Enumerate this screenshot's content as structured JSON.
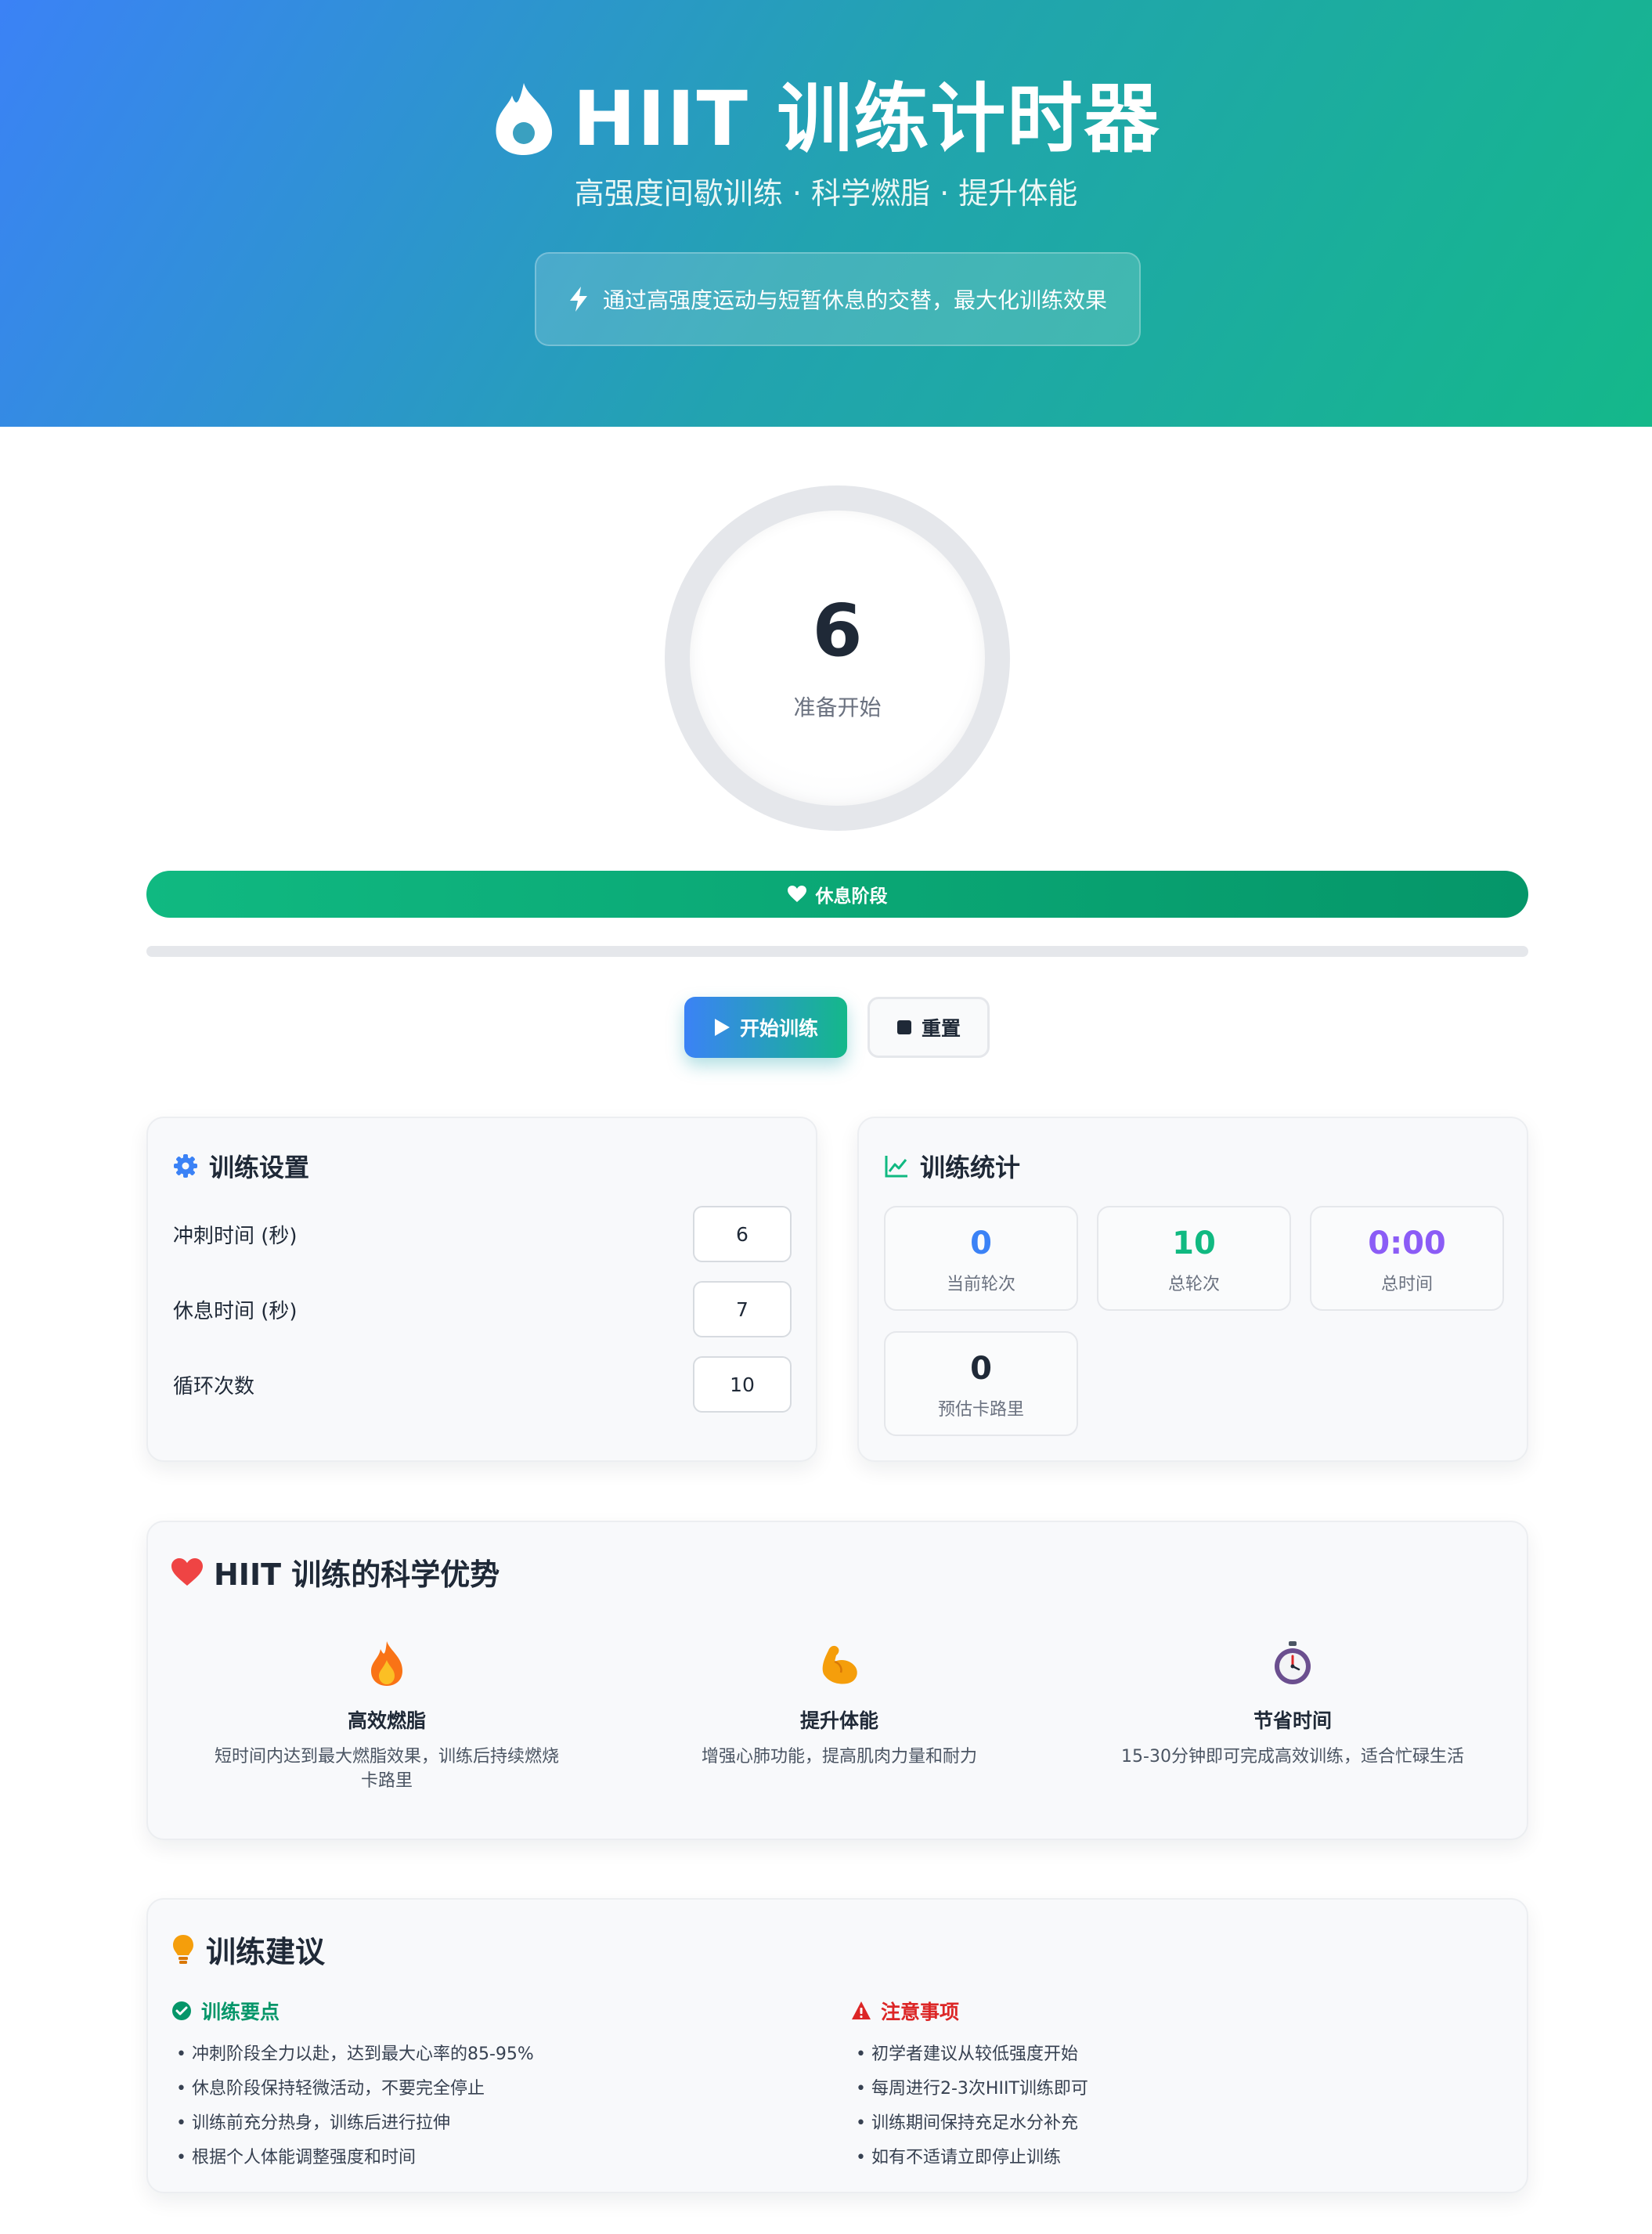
{
  "header": {
    "title": "HIIT 训练计时器",
    "subtitle": "高强度间歇训练 · 科学燃脂 · 提升体能",
    "note": "通过高强度运动与短暂休息的交替，最大化训练效果",
    "icon": "flame-icon"
  },
  "timer": {
    "number": "6",
    "label": "准备开始",
    "phase_label": "休息阶段",
    "phase_icon": "heart-icon",
    "progress_fraction": 0
  },
  "controls": {
    "start_label": "开始训练",
    "reset_label": "重置"
  },
  "settings": {
    "title": "训练设置",
    "sprint_label": "冲刺时间 (秒)",
    "sprint_value": "6",
    "rest_label": "休息时间 (秒)",
    "rest_value": "7",
    "cycles_label": "循环次数",
    "cycles_value": "10"
  },
  "stats": {
    "title": "训练统计",
    "current_round": {
      "value": "0",
      "caption": "当前轮次",
      "color": "#3b82f6"
    },
    "total_rounds": {
      "value": "10",
      "caption": "总轮次",
      "color": "#10b981"
    },
    "total_time": {
      "value": "0:00",
      "caption": "总时间",
      "color": "#8b5cf6"
    },
    "calories": {
      "value": "0",
      "caption": "预估卡路里",
      "color": "#1f2937"
    }
  },
  "benefits": {
    "title": "HIIT 训练的科学优势",
    "items": [
      {
        "icon": "fire-emoji-icon",
        "title": "高效燃脂",
        "desc": "短时间内达到最大燃脂效果，训练后持续燃烧卡路里"
      },
      {
        "icon": "muscle-emoji-icon",
        "title": "提升体能",
        "desc": "增强心肺功能，提高肌肉力量和耐力"
      },
      {
        "icon": "stopwatch-emoji-icon",
        "title": "节省时间",
        "desc": "15-30分钟即可完成高效训练，适合忙碌生活"
      }
    ]
  },
  "advice": {
    "title": "训练建议",
    "left_heading": "训练要点",
    "left_items": [
      "冲刺阶段全力以赴，达到最大心率的85-95%",
      "休息阶段保持轻微活动，不要完全停止",
      "训练前充分热身，训练后进行拉伸",
      "根据个人体能调整强度和时间"
    ],
    "right_heading": "注意事项",
    "right_items": [
      "初学者建议从较低强度开始",
      "每周进行2-3次HIIT训练即可",
      "训练期间保持充足水分补充",
      "如有不适请立即停止训练"
    ]
  },
  "colors": {
    "accent_blue": "#3b82f6",
    "accent_green": "#10b981",
    "accent_purple": "#8b5cf6",
    "warning_red": "#dc2626",
    "success_green": "#059669"
  }
}
